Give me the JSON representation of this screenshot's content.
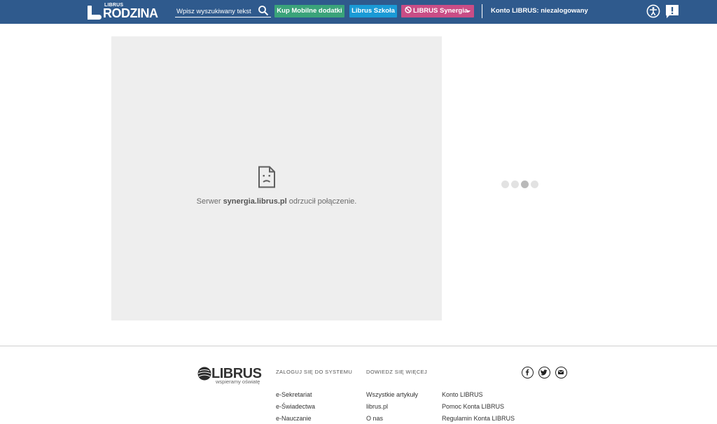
{
  "header": {
    "logo": {
      "sup": "LIBRUS",
      "main": "RODZINA"
    },
    "search": {
      "placeholder": "Wpisz wyszukiwany tekst"
    },
    "buttons": {
      "mobile": "Kup Mobilne dodatki",
      "szkola": "Librus Szkoła",
      "synergia": "LIBRUS Synergia"
    },
    "account_status": "Konto LIBRUS: niezalogowany",
    "icons": {
      "accessibility": "accessibility-icon",
      "feedback": "feedback-icon",
      "search": "search-icon",
      "blocked": "ban-icon"
    },
    "colors": {
      "bar": "#2f5a8d",
      "mobile": "#3aa37a",
      "szkola": "#1a9ad6",
      "synergia": "#c94d86"
    }
  },
  "main": {
    "error": {
      "prefix": "Serwer ",
      "host": "synergia.librus.pl",
      "suffix": " odrzucił połączenie."
    },
    "icons": {
      "error": "sad-document-icon",
      "loader": "loading-dots"
    }
  },
  "footer": {
    "logo": {
      "word": "LIBRUS",
      "tagline": "wspieramy oświatę"
    },
    "col1": {
      "heading": "ZALOGUJ SIĘ DO SYSTEMU",
      "links": [
        "e-Sekretariat",
        "e-Świadectwa",
        "e-Nauczanie"
      ]
    },
    "col2": {
      "heading": "DOWIEDZ SIĘ WIĘCEJ",
      "links": [
        "Wszystkie artykuły",
        "librus.pl",
        "O nas"
      ]
    },
    "col3": {
      "links": [
        "Konto LIBRUS",
        "Pomoc Konta LIBRUS",
        "Regulamin Konta LIBRUS"
      ]
    },
    "social": [
      "facebook-icon",
      "twitter-icon",
      "mail-icon"
    ]
  }
}
